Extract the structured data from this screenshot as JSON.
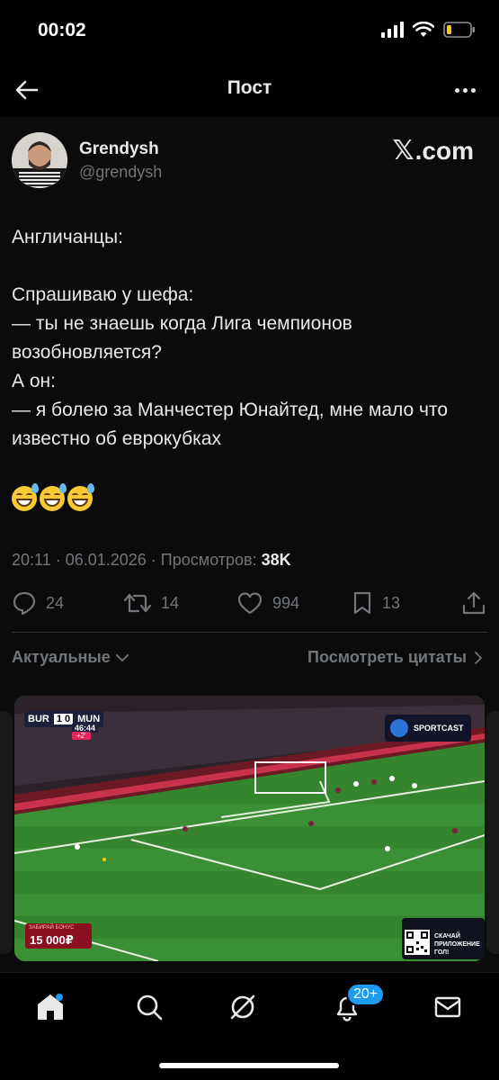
{
  "status_bar": {
    "time": "00:02"
  },
  "nav": {
    "title": "Пост"
  },
  "post": {
    "author_name": "Grendysh",
    "author_handle": "@grendysh",
    "source_label": ".com",
    "text": "Англичанцы:\n\nСпрашиваю у шефа:\n— ты не знаешь когда Лига чемпионов возобновляется?\nА он:\n— я болею за Манчестер Юнайтед, мне мало что известно об еврокубках",
    "emoji": [
      "grinning-sweat-emoji",
      "grinning-sweat-emoji",
      "grinning-sweat-emoji"
    ],
    "meta_prefix": "20:11 · 06.01.2026 · Просмотров: ",
    "views": "38K"
  },
  "actions": {
    "replies": "24",
    "reposts": "14",
    "likes": "994",
    "bookmarks": "13"
  },
  "filters": {
    "relevant_label": "Актуальные",
    "quotes_label": "Посмотреть цитаты"
  },
  "media": {
    "home_team": "BUR",
    "score": "1 0",
    "away_team": "MUN",
    "clock": "46:44",
    "added_time": "+2'",
    "broadcaster": "SPORTCAST",
    "promo_small": "ЗАБИРАЙ БОНУС",
    "promo_amount": "15 000₽",
    "qr_caption": "СКАЧАЙ ПРИЛОЖЕНИЕ ГОЛ!"
  },
  "tabbar": {
    "notifications_badge": "20+"
  },
  "colors": {
    "background": "#000000",
    "card": "#0b0b0b",
    "text_primary": "#e7e9ea",
    "text_secondary": "#71767b",
    "accent_blue": "#1d9bf0",
    "divider": "#2f3336"
  }
}
